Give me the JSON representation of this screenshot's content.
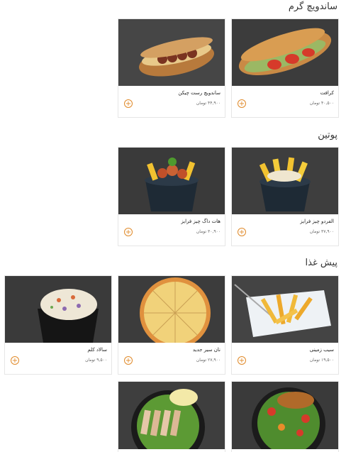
{
  "sections": [
    {
      "title": "ساندویچ گرم",
      "items": [
        {
          "name": "کرافت",
          "price": "۴۰,۵۰۰ تومان"
        },
        {
          "name": "ساندویچ رست چیکن",
          "price": "۴۴,۹۰۰ تومان"
        }
      ]
    },
    {
      "title": "پوتین",
      "items": [
        {
          "name": "الفردو چیز فرایز",
          "price": "۳۷,۹۰۰ تومان"
        },
        {
          "name": "هات داگ چیز فرایز",
          "price": "۳۰,۹۰۰ تومان"
        }
      ]
    },
    {
      "title": "پیش غذا",
      "items": [
        {
          "name": "سیب زمینی",
          "price": "۱۹,۵۰۰ تومان"
        },
        {
          "name": "نان سیر جدید",
          "price": "۲۷,۹۰۰ تومان"
        },
        {
          "name": "سالاد کلم",
          "price": "۹,۵۰۰ تومان"
        }
      ]
    }
  ],
  "add_glyph": "+",
  "colors": {
    "accent": "#e08a2a",
    "photo_bg": "#4a4a4a"
  }
}
